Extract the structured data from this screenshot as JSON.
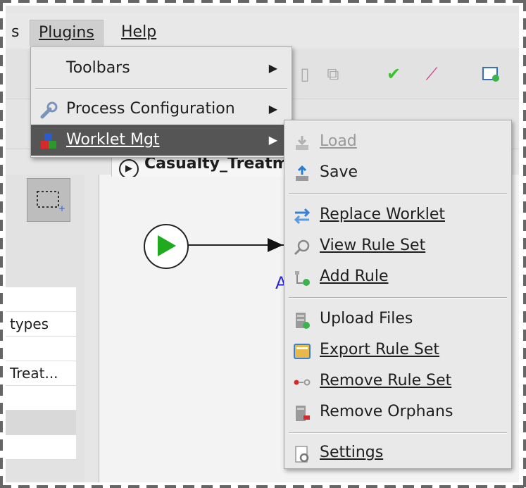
{
  "menubar": {
    "items": [
      "s",
      "Plugins",
      "Help"
    ]
  },
  "plugins_menu": {
    "items": [
      {
        "label": "Toolbars",
        "has_submenu": true,
        "icon": "none"
      },
      {
        "label": "Process Configuration",
        "has_submenu": true,
        "icon": "wrench-icon"
      },
      {
        "label": "Worklet Mgt",
        "has_submenu": true,
        "icon": "worklet-blocks-icon",
        "selected": true
      }
    ]
  },
  "worklet_menu": {
    "items": [
      {
        "label": "Load",
        "disabled": true,
        "icon": "load-icon"
      },
      {
        "label": "Save",
        "icon": "save-icon"
      },
      {
        "label": "Replace Worklet",
        "icon": "replace-worklet-icon"
      },
      {
        "label": "View Rule Set",
        "icon": "view-rule-set-icon"
      },
      {
        "label": "Add Rule",
        "icon": "add-rule-icon"
      },
      {
        "label": "Upload Files",
        "icon": "upload-files-icon"
      },
      {
        "label": "Export Rule Set",
        "icon": "export-rule-set-icon"
      },
      {
        "label": "Remove Rule Set",
        "icon": "remove-rule-set-icon"
      },
      {
        "label": "Remove Orphans",
        "icon": "remove-orphans-icon"
      },
      {
        "label": "Settings",
        "icon": "settings-icon"
      }
    ]
  },
  "editor": {
    "tab_title": "Casualty_Treatm",
    "task_label": "A"
  },
  "left_panel": {
    "rows": [
      "",
      "types",
      "",
      "Treat...",
      "",
      "",
      ""
    ]
  },
  "colors": {
    "selected_bg": "#555555",
    "start_green": "#1faa1f",
    "task_label": "#2a2ad0"
  }
}
